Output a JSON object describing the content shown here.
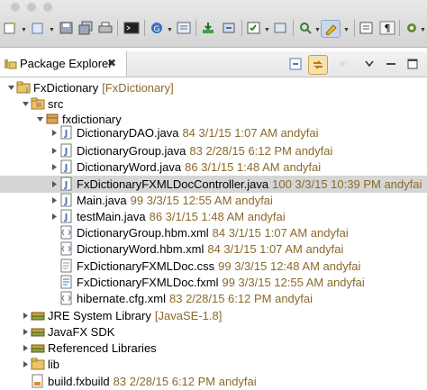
{
  "view": {
    "tab_label": "Package Explorer",
    "close_glyph": "✖"
  },
  "tree": [
    {
      "label": "FxDictionary",
      "deco": "[FxDictionary]",
      "icon": "project-icon",
      "expanded": true
    },
    {
      "label": "src",
      "deco": "",
      "icon": "source-folder-icon",
      "expanded": true
    },
    {
      "label": "fxdictionary",
      "deco": "",
      "icon": "package-icon",
      "expanded": true
    },
    {
      "label": "DictionaryDAO.java",
      "deco": "84  3/1/15 1:07 AM  andyfai",
      "icon": "java-file-icon",
      "expanded": false
    },
    {
      "label": "DictionaryGroup.java",
      "deco": "83  2/28/15 6:12 PM  andyfai",
      "icon": "java-file-icon",
      "expanded": false
    },
    {
      "label": "DictionaryWord.java",
      "deco": "86  3/1/15 1:48 AM  andyfai",
      "icon": "java-file-icon",
      "expanded": false
    },
    {
      "label": "FxDictionaryFXMLDocController.java",
      "deco": "100  3/3/15 10:39 PM  andyfai",
      "icon": "java-file-icon",
      "expanded": false,
      "selected": true
    },
    {
      "label": "Main.java",
      "deco": "99  3/3/15 12:55 AM  andyfai",
      "icon": "java-file-icon",
      "expanded": false
    },
    {
      "label": "testMain.java",
      "deco": "86  3/1/15 1:48 AM  andyfai",
      "icon": "java-file-icon",
      "expanded": false
    },
    {
      "label": "DictionaryGroup.hbm.xml",
      "deco": "84  3/1/15 1:07 AM  andyfai",
      "icon": "xml-file-icon"
    },
    {
      "label": "DictionaryWord.hbm.xml",
      "deco": "84  3/1/15 1:07 AM  andyfai",
      "icon": "xml-file-icon"
    },
    {
      "label": "FxDictionaryFXMLDoc.css",
      "deco": "99  3/3/15 12:48 AM  andyfai",
      "icon": "css-file-icon"
    },
    {
      "label": "FxDictionaryFXMLDoc.fxml",
      "deco": "99  3/3/15 12:55 AM  andyfai",
      "icon": "fxml-file-icon"
    },
    {
      "label": "hibernate.cfg.xml",
      "deco": "83  2/28/15 6:12 PM  andyfai",
      "icon": "xml-file-icon"
    },
    {
      "label": "JRE System Library",
      "deco": "[JavaSE-1.8]",
      "icon": "library-icon",
      "expanded": false
    },
    {
      "label": "JavaFX SDK",
      "deco": "",
      "icon": "library-icon",
      "expanded": false
    },
    {
      "label": "Referenced Libraries",
      "deco": "",
      "icon": "library-icon",
      "expanded": false
    },
    {
      "label": "lib",
      "deco": "",
      "icon": "folder-icon",
      "expanded": false
    },
    {
      "label": "build.fxbuild",
      "deco": "83  2/28/15 6:12 PM  andyfai",
      "icon": "fxbuild-file-icon"
    }
  ],
  "colors": {
    "decoration": "#8b6a2a",
    "selection": "#d6d6d6",
    "folder": "#e9c46a",
    "java": "#4a72b8"
  }
}
